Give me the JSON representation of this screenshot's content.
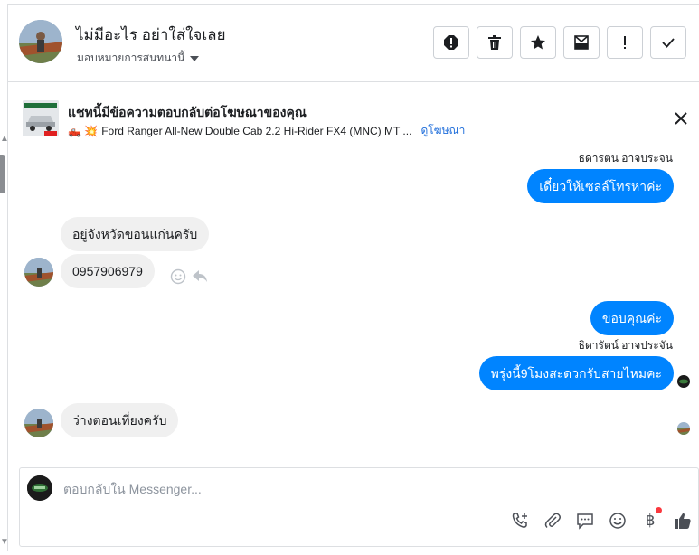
{
  "conversation": {
    "name": "ไม่มีอะไร อย่าใส่ใจเลย",
    "assign_label": "มอบหมายการสนทนานี้"
  },
  "header_actions": [
    {
      "icon": "spam-icon"
    },
    {
      "icon": "trash-icon"
    },
    {
      "icon": "star-icon"
    },
    {
      "icon": "mark-unread-icon"
    },
    {
      "icon": "follow-up-icon"
    },
    {
      "icon": "done-check-icon"
    }
  ],
  "ad_banner": {
    "title": "แชทนี้มีข้อความตอบกลับต่อโฆษณาของคุณ",
    "emoji": "🛻 💥",
    "product": "Ford Ranger All-New Double Cab 2.2 Hi-Rider FX4 (MNC) MT ...",
    "link": "ดูโฆษณา"
  },
  "messages": [
    {
      "type": "out",
      "sender": "ธิดารัตน์ อาจประจัน",
      "text": "เดี๋ยวให้เซลล์โทรหาค่ะ"
    },
    {
      "type": "in",
      "text": "อยู่จังหวัดขอนแก่นครับ"
    },
    {
      "type": "in",
      "text": "0957906979"
    },
    {
      "type": "out",
      "text": "ขอบคุณค่ะ"
    },
    {
      "type": "out",
      "sender": "ธิดารัตน์ อาจประจัน",
      "text": "พรุ่งนี้9โมงสะดวกรับสายไหมคะ"
    },
    {
      "type": "in",
      "text": "ว่างตอนเที่ยงครับ"
    }
  ],
  "composer": {
    "placeholder": "ตอบกลับใน Messenger..."
  },
  "colors": {
    "outgoing_bubble": "#0084ff",
    "incoming_bubble": "#f0f0f0",
    "link": "#216fdb",
    "notification_dot": "#fa383e"
  }
}
